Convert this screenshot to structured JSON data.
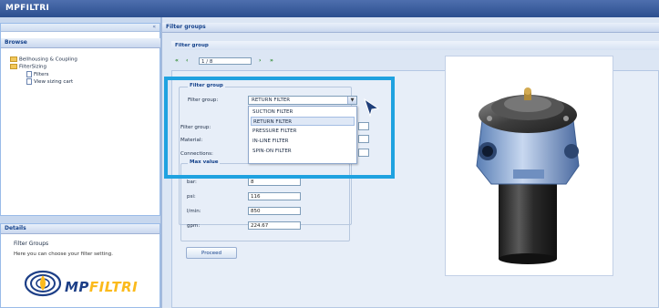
{
  "app": {
    "title": "MPFILTRI"
  },
  "sidebar": {
    "browse_title": "Browse",
    "collapse_glyph": "«",
    "tree": [
      {
        "label": "Bellhousing & Coupling",
        "icon": "folder-icon"
      },
      {
        "label": "FilterSizing",
        "icon": "folder-icon"
      },
      {
        "label": "Filters",
        "icon": "file-icon"
      },
      {
        "label": "View sizing cart",
        "icon": "file-icon"
      }
    ]
  },
  "details": {
    "title": "Details",
    "heading": "Filter Groups",
    "text": "Here you can choose your filter setting.",
    "logo_text_mp": "MP",
    "logo_text_filtri": "FILTRI"
  },
  "main": {
    "panel_title": "Filter groups",
    "sub_title": "Filter group",
    "pager": {
      "first": "«",
      "prev": "‹",
      "value": "1 / 8",
      "next": "›",
      "last": "»"
    },
    "form": {
      "group_legend": "Filter group",
      "select_label": "Filter group:",
      "selected_value": "RETURN FILTER",
      "options": [
        "SUCTION FILTER",
        "RETURN FILTER",
        "PRESSURE FILTER",
        "IN-LINE FILTER",
        "SPIN-ON FILTER"
      ],
      "filter_group_label": "Filter group:",
      "material_label": "Material:",
      "connections_label": "Connections:",
      "max_value_legend": "Max value",
      "fields": [
        {
          "label": "bar:",
          "value": "8"
        },
        {
          "label": "psi:",
          "value": "116"
        },
        {
          "label": "l/min:",
          "value": "850"
        },
        {
          "label": "gpm:",
          "value": "224.67"
        }
      ],
      "proceed_label": "Proceed"
    }
  },
  "colors": {
    "highlight": "#1fa2e0",
    "titlebar": "#2c4f8f",
    "brand_blue": "#1d3f87",
    "brand_yellow": "#fbba1c"
  }
}
